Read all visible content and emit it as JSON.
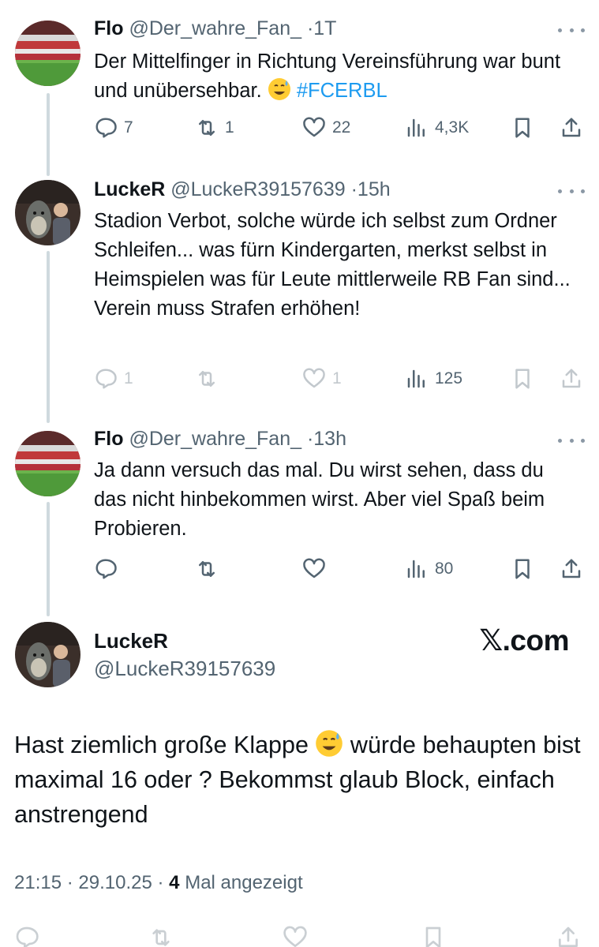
{
  "tweets": [
    {
      "name": "Flo",
      "handle": "@Der_wahre_Fan_",
      "dot": "·",
      "time": "1T",
      "text": "Der Mittelfinger in Richtung Vereinsführung war bunt und unübersehbar.",
      "hashtag": "#FCERBL",
      "emoji": "grinning-sweat-emoji",
      "replies": "7",
      "retweets": "1",
      "likes": "22",
      "views": "4,3K"
    },
    {
      "name": "LuckeR",
      "handle": "@LuckeR39157639",
      "dot": "·",
      "time": "15h",
      "text": "Stadion Verbot, solche würde ich selbst zum Ordner Schleifen... was fürn Kindergarten, merkst selbst in Heimspielen was für Leute mittlerweile RB Fan sind... Verein muss Strafen erhöhen!",
      "replies": "1",
      "retweets": "",
      "likes": "1",
      "views": "125"
    },
    {
      "name": "Flo",
      "handle": "@Der_wahre_Fan_",
      "dot": "·",
      "time": "13h",
      "text": "Ja dann versuch das mal. Du wirst sehen, dass du das nicht hinbekommen wirst. Aber viel Spaß beim Probieren.",
      "replies": "",
      "retweets": "",
      "likes": "",
      "views": "80"
    }
  ],
  "main_tweet": {
    "name": "LuckeR",
    "handle": "@LuckeR39157639",
    "watermark": "𝕏.com",
    "text_part1": "Hast ziemlich große Klappe",
    "emoji": "grinning-sweat-emoji",
    "text_part2": "würde behaupten bist maximal 16 oder ? Bekommst glaub Block, einfach anstrengend",
    "time": "21:15",
    "dot": "·",
    "date": "29.10.25",
    "dot2": "·",
    "views_count": "4",
    "views_label": "Mal angezeigt"
  },
  "colors": {
    "text": "#0f1419",
    "secondary": "#536471",
    "link": "#1d9bf0",
    "thread_line": "#cfd9de"
  },
  "icons": [
    "reply-icon",
    "retweet-icon",
    "like-icon",
    "views-icon",
    "bookmark-icon",
    "share-icon",
    "more-icon"
  ]
}
